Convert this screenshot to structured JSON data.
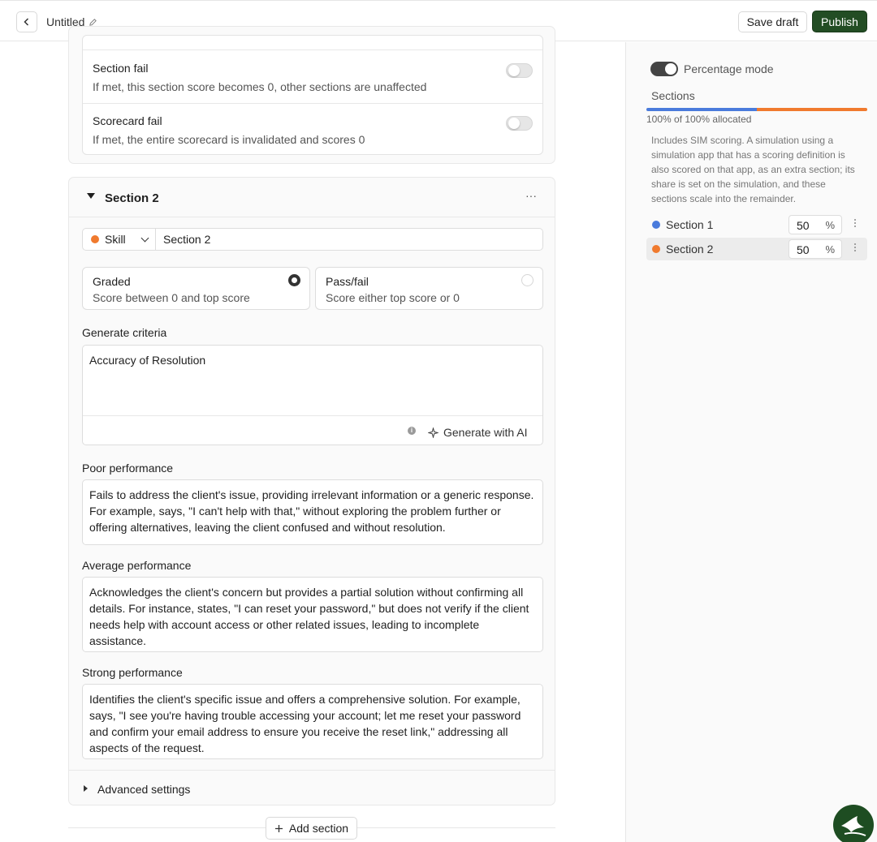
{
  "header": {
    "title": "Untitled",
    "save_draft_label": "Save draft",
    "publish_label": "Publish"
  },
  "fail_rules": [
    {
      "title": "Section fail",
      "description": "If met, this section score becomes 0, other sections are unaffected"
    },
    {
      "title": "Scorecard fail",
      "description": "If met, the entire scorecard is invalidated and scores 0"
    }
  ],
  "section2": {
    "title": "Section 2",
    "more_label": "···",
    "type_label": "Skill",
    "name_value": "Section 2",
    "graded": {
      "title": "Graded",
      "description": "Score between 0 and top score"
    },
    "passfail": {
      "title": "Pass/fail",
      "description": "Score either top score or 0"
    },
    "generate_label": "Generate criteria",
    "generate_text": "Accuracy of Resolution",
    "generate_ai_label": "Generate with AI",
    "poor_label": "Poor performance",
    "poor_text": "Fails to address the client's issue, providing irrelevant information or a generic response. For example, says, \"I can't help with that,\" without exploring the problem further or offering alternatives, leaving the client confused and without resolution.",
    "average_label": "Average performance",
    "average_text": "Acknowledges the client's concern but provides a partial solution without confirming all details. For instance, states, \"I can reset your password,\" but does not verify if the client needs help with account access or other related issues, leading to incomplete assistance.",
    "strong_label": "Strong performance",
    "strong_text": "Identifies the client's specific issue and offers a comprehensive solution. For example, says, \"I see you're having trouble accessing your account; let me reset your password and confirm your email address to ensure you receive the reset link,\" addressing all aspects of the request.",
    "advanced_label": "Advanced settings"
  },
  "add_section_label": "Add section",
  "panel": {
    "percentage_mode_label": "Percentage mode",
    "sections_label": "Sections",
    "allocated_text": "100% of 100% allocated",
    "note": "Includes SIM scoring. A simulation using a simulation app that has a scoring definition is also scored on that app, as an extra section; its share is set on the simulation, and these sections scale into the remainder.",
    "sections": [
      {
        "name": "Section 1",
        "percent": "50",
        "share": 50,
        "color": "#4a7bdc"
      },
      {
        "name": "Section 2",
        "percent": "50",
        "share": 50,
        "color": "#f07a2e"
      }
    ],
    "percent_sign": "%"
  },
  "colors": {
    "publish": "#234d24",
    "section1": "#4a7bdc",
    "section2": "#f07a2e"
  }
}
